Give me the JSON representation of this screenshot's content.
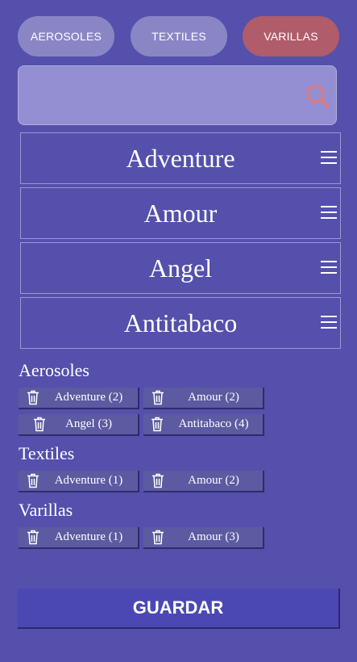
{
  "tabs": [
    {
      "label": "AEROSOLES",
      "active": false
    },
    {
      "label": "TEXTILES",
      "active": false
    },
    {
      "label": "VARILLAS",
      "active": true
    }
  ],
  "colors": {
    "background": "#5450ac",
    "tab": "#8a86c6",
    "tab_active": "#b05c6a",
    "search_bg": "#938fd2",
    "search_icon": "#e07a7a",
    "save_button": "#4b48b4"
  },
  "search": {
    "value": "",
    "placeholder": "",
    "icon": "search-icon"
  },
  "list": [
    {
      "label": "Adventure"
    },
    {
      "label": "Amour"
    },
    {
      "label": "Angel"
    },
    {
      "label": "Antitabaco"
    }
  ],
  "sections": [
    {
      "title": "Aerosoles",
      "chips": [
        "Adventure (2)",
        "Amour (2)",
        "Angel (3)",
        "Antitabaco (4)"
      ]
    },
    {
      "title": "Textiles",
      "chips": [
        "Adventure (1)",
        "Amour (2)"
      ]
    },
    {
      "title": "Varillas",
      "chips": [
        "Adventure (1)",
        "Amour (3)"
      ]
    }
  ],
  "save_label": "GUARDAR"
}
